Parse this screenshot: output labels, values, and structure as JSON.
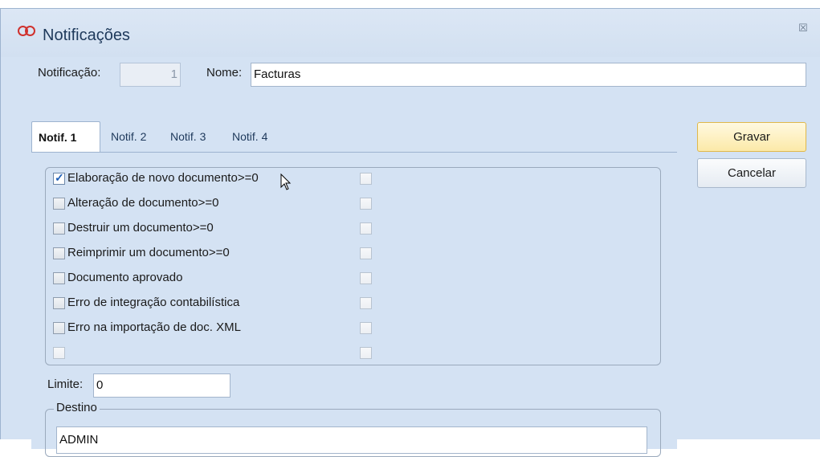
{
  "window": {
    "title": "Notificações",
    "close_symbol": "☒"
  },
  "header": {
    "notificacao_label": "Notificação:",
    "notificacao_value": "1",
    "nome_label": "Nome:",
    "nome_value": "Facturas"
  },
  "tabs": [
    {
      "label": "Notif. 1",
      "active": true
    },
    {
      "label": "Notif. 2",
      "active": false
    },
    {
      "label": "Notif. 3",
      "active": false
    },
    {
      "label": "Notif. 4",
      "active": false
    }
  ],
  "events": [
    {
      "label": "Elaboração de novo documento>=0",
      "checked": true
    },
    {
      "label": "Alteração de documento>=0",
      "checked": false
    },
    {
      "label": "Destruir um documento>=0",
      "checked": false
    },
    {
      "label": "Reimprimir um documento>=0",
      "checked": false
    },
    {
      "label": "Documento aprovado",
      "checked": false
    },
    {
      "label": "Erro de integração contabilística",
      "checked": false
    },
    {
      "label": "Erro na importação de doc. XML",
      "checked": false
    },
    {
      "label": "",
      "checked": false
    }
  ],
  "limite": {
    "label": "Limite:",
    "value": "0"
  },
  "destino": {
    "legend": "Destino",
    "value": "ADMIN"
  },
  "buttons": {
    "save": "Gravar",
    "cancel": "Cancelar"
  },
  "colors": {
    "window_bg": "#d4e2f3",
    "title_text": "#1e395b",
    "accent": "#d0312d",
    "primary_button": "#fce9a8"
  }
}
